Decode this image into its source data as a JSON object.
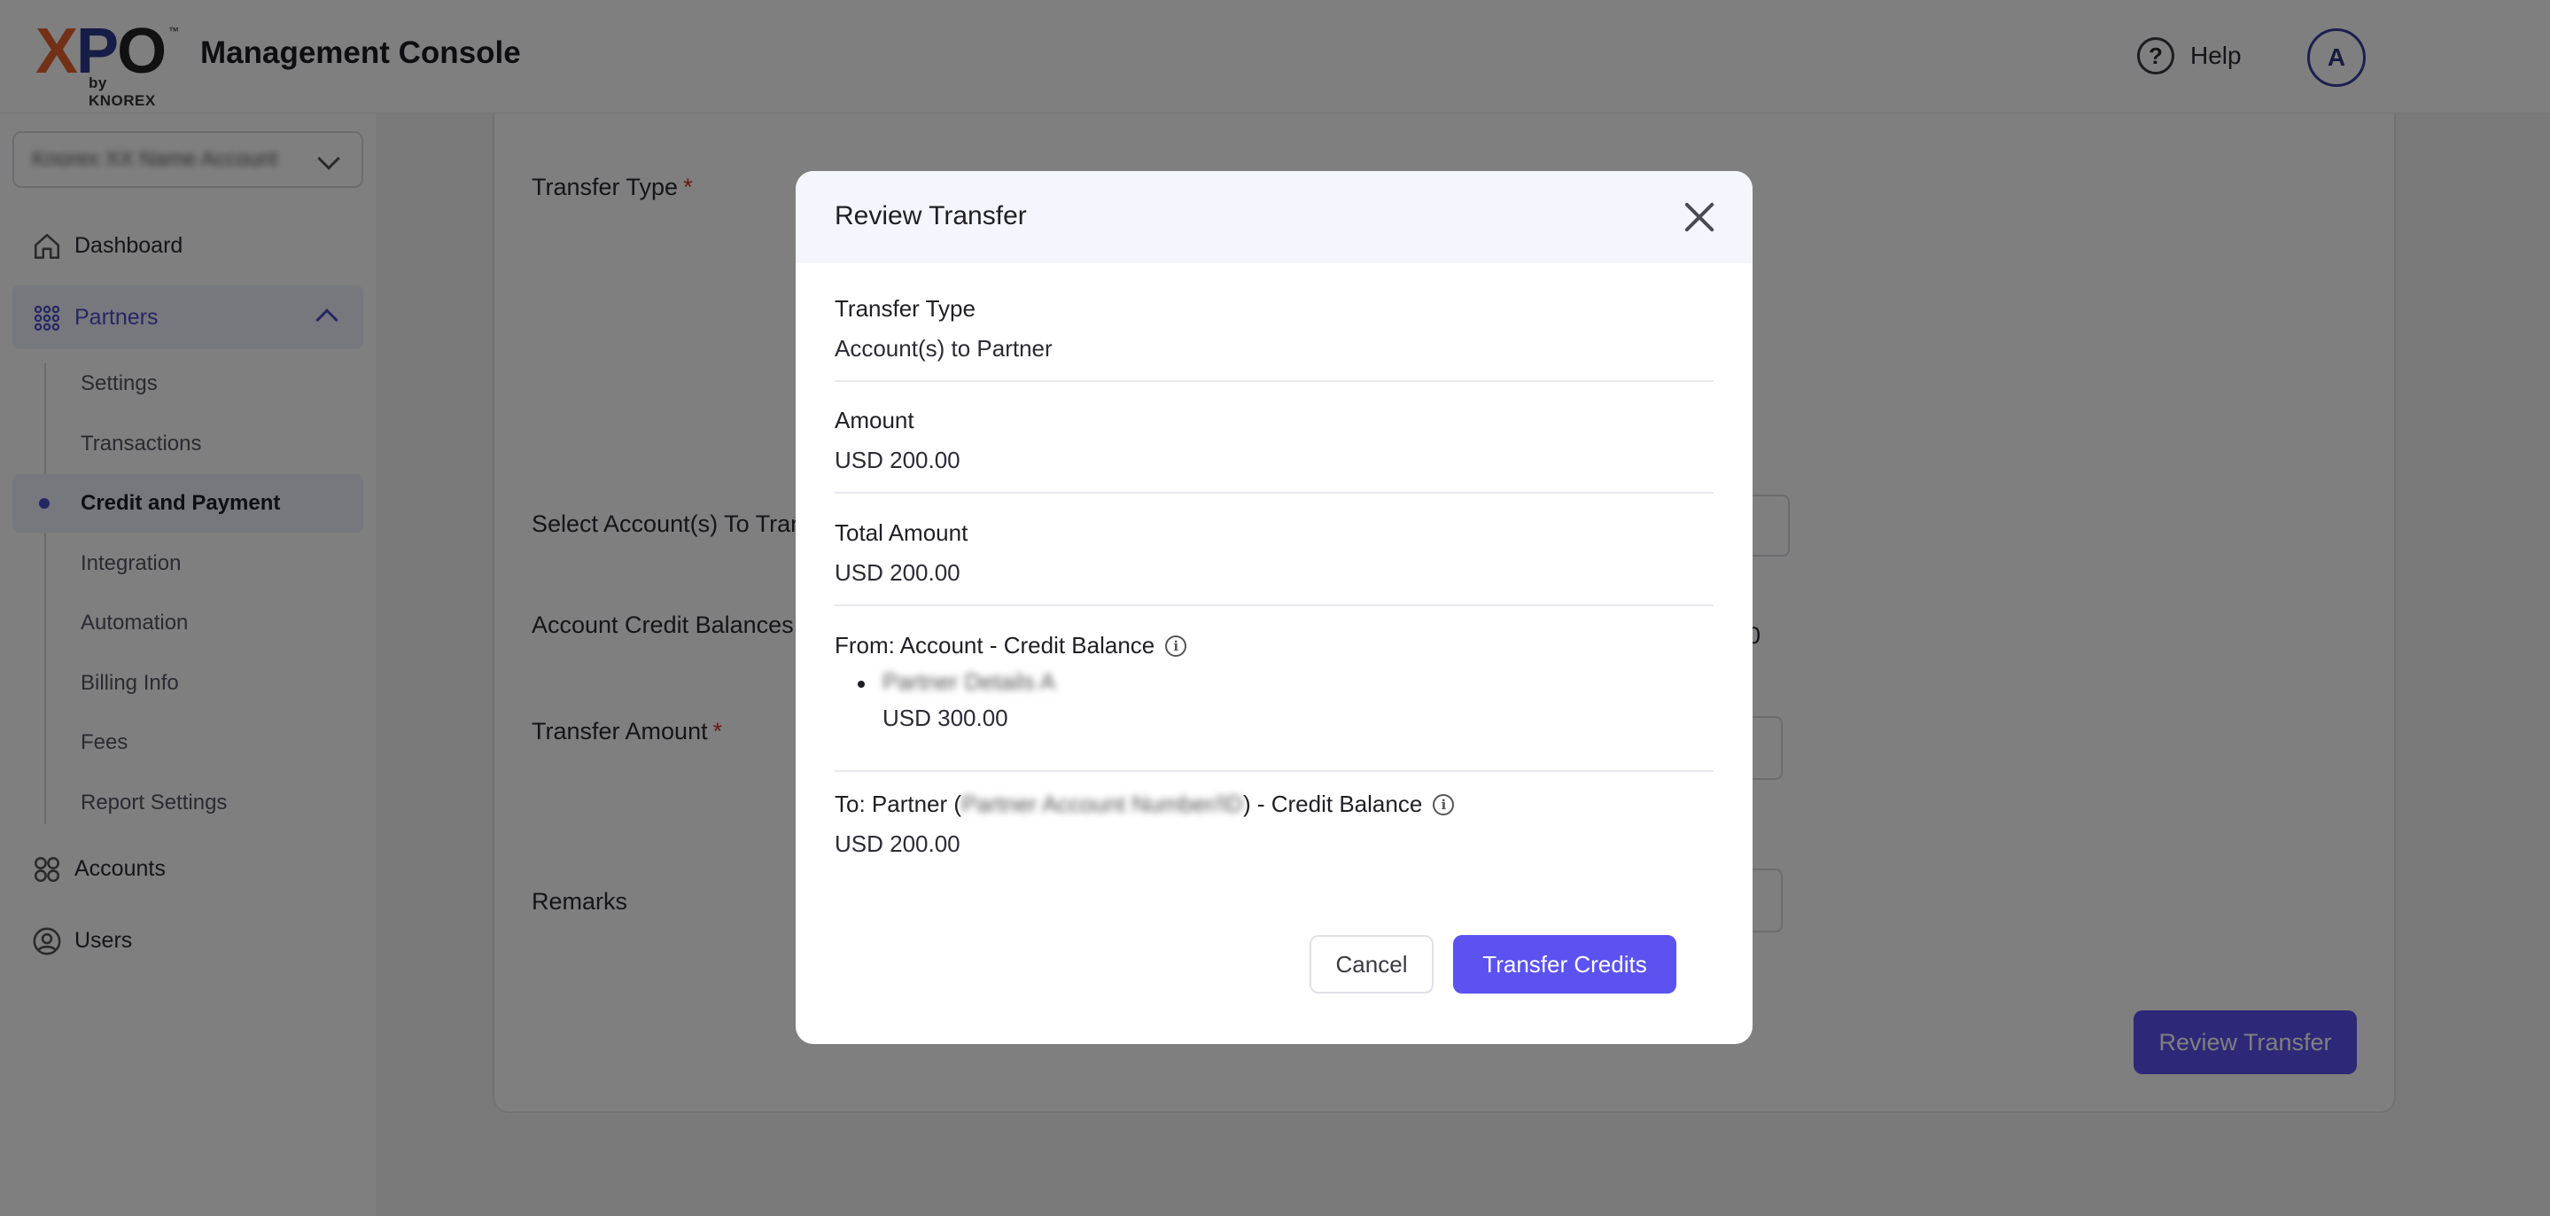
{
  "header": {
    "logo_text": "XPO",
    "logo_tm": "™",
    "logo_by": "by KNOREX",
    "app_title": "Management Console",
    "help_label": "Help",
    "avatar_initial": "A"
  },
  "sidebar": {
    "account_selector": "Knorex XX Name Account",
    "items": [
      {
        "label": "Dashboard",
        "icon": "home-icon"
      },
      {
        "label": "Partners",
        "icon": "grid-icon"
      },
      {
        "label": "Accounts",
        "icon": "apps-icon"
      },
      {
        "label": "Users",
        "icon": "user-icon"
      }
    ],
    "partners_sub": [
      {
        "label": "Settings"
      },
      {
        "label": "Transactions"
      },
      {
        "label": "Credit and Payment"
      },
      {
        "label": "Integration"
      },
      {
        "label": "Automation"
      },
      {
        "label": "Billing Info"
      },
      {
        "label": "Fees"
      },
      {
        "label": "Report Settings"
      }
    ]
  },
  "form": {
    "transfer_type_label": "Transfer Type",
    "select_accounts_label": "Select Account(s) To Transfer",
    "account_credit_label": "Account Credit Balances",
    "account_credit_partial": "0",
    "transfer_amount_label": "Transfer Amount",
    "remarks_label": "Remarks",
    "required_mark": "*",
    "review_button": "Review Transfer"
  },
  "modal": {
    "title": "Review Transfer",
    "transfer_type_label": "Transfer Type",
    "transfer_type_value": "Account(s) to Partner",
    "amount_label": "Amount",
    "amount_value": "USD 200.00",
    "total_label": "Total Amount",
    "total_value": "USD 200.00",
    "from_label": "From: Account - Credit Balance",
    "from_account_name": "Partner Details A",
    "from_account_value": "USD 300.00",
    "to_label_prefix": "To: Partner (",
    "to_partner_name": "Partner Account Number/ID",
    "to_label_suffix": ") - Credit Balance",
    "to_value": "USD 200.00",
    "cancel_label": "Cancel",
    "confirm_label": "Transfer Credits"
  },
  "colors": {
    "accent": "#5b52f0",
    "nav_active": "#4a4fc8",
    "required": "#d62d2d"
  }
}
